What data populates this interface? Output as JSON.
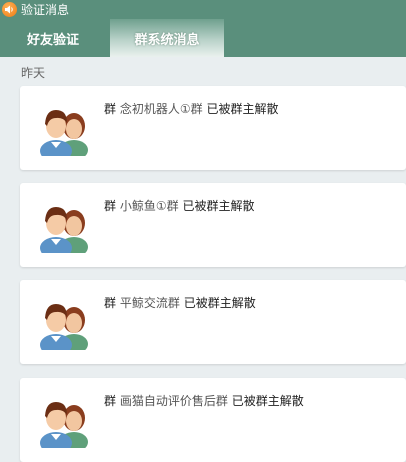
{
  "titlebar": {
    "title": "验证消息",
    "icon": "speaker-icon"
  },
  "tabs": [
    {
      "label": "好友验证",
      "active": false
    },
    {
      "label": "群系统消息",
      "active": true
    }
  ],
  "section": {
    "date_label": "昨天"
  },
  "messages": [
    {
      "prefix": "群",
      "group": "念初机器人①群",
      "status": "已被群主解散"
    },
    {
      "prefix": "群",
      "group": "小鲸鱼①群",
      "status": "已被群主解散"
    },
    {
      "prefix": "群",
      "group": "平鲸交流群",
      "status": "已被群主解散"
    },
    {
      "prefix": "群",
      "group": "画猫自动评价售后群",
      "status": "已被群主解散"
    }
  ],
  "colors": {
    "header_green": "#5a8f7c",
    "background": "#e9eef0",
    "card": "#ffffff"
  }
}
